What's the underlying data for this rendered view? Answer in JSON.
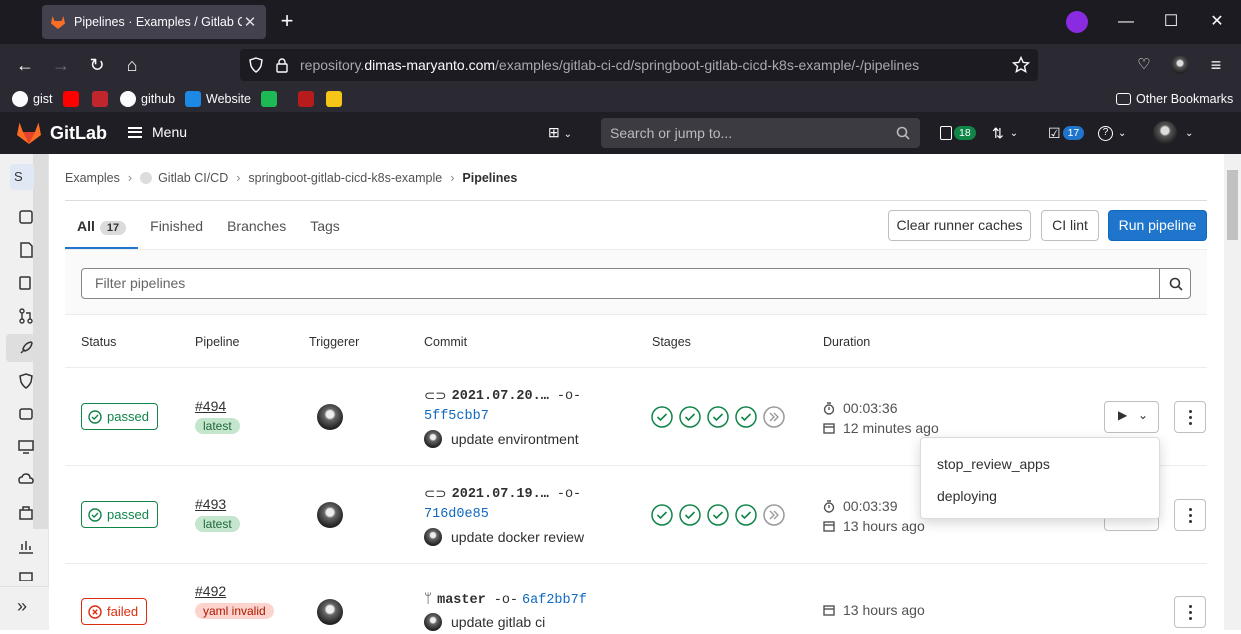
{
  "browser": {
    "tab_title": "Pipelines · Examples / Gitlab CI/",
    "new_tab": "+",
    "url_prefix": "repository.",
    "url_domain": "dimas-maryanto.com",
    "url_path": "/examples/gitlab-ci-cd/springboot-gitlab-cicd-k8s-example/-/pipelines",
    "bookmarks": [
      "gist",
      "github",
      "Website"
    ],
    "other_bookmarks": "Other Bookmarks"
  },
  "gitlab": {
    "brand": "GitLab",
    "menu": "Menu",
    "search_placeholder": "Search or jump to...",
    "issues_count": "18",
    "todos_count": "17"
  },
  "sidebar": {
    "project_initial": "S"
  },
  "breadcrumb": [
    "Examples",
    "Gitlab CI/CD",
    "springboot-gitlab-cicd-k8s-example",
    "Pipelines"
  ],
  "tabs": [
    {
      "label": "All",
      "count": "17",
      "active": true
    },
    {
      "label": "Finished"
    },
    {
      "label": "Branches"
    },
    {
      "label": "Tags"
    }
  ],
  "buttons": {
    "clear_cache": "Clear runner caches",
    "ci_lint": "CI lint",
    "run_pipeline": "Run pipeline"
  },
  "filter": {
    "placeholder": "Filter pipelines"
  },
  "columns": [
    "Status",
    "Pipeline",
    "Triggerer",
    "Commit",
    "Stages",
    "Duration"
  ],
  "pipelines": [
    {
      "status": "passed",
      "id": "#494",
      "tag": "latest",
      "ref": "2021.07.20.…",
      "sha": "5ff5cbb7",
      "message": "update environtment",
      "duration": "00:03:36",
      "finished": "12 minutes ago"
    },
    {
      "status": "passed",
      "id": "#493",
      "tag": "latest",
      "ref": "2021.07.19.…",
      "sha": "716d0e85",
      "message": "update docker review",
      "duration": "00:03:39",
      "finished": "13 hours ago"
    },
    {
      "status": "failed",
      "id": "#492",
      "tag": "yaml invalid",
      "ref": "master",
      "sha": "6af2bb7f",
      "message": "update gitlab ci",
      "finished": "13 hours ago"
    }
  ],
  "dropdown": [
    "stop_review_apps",
    "deploying"
  ],
  "colors": {
    "primary": "#1f75cb",
    "success": "#108548",
    "danger": "#dd2b0e",
    "header": "#1f1e24"
  }
}
